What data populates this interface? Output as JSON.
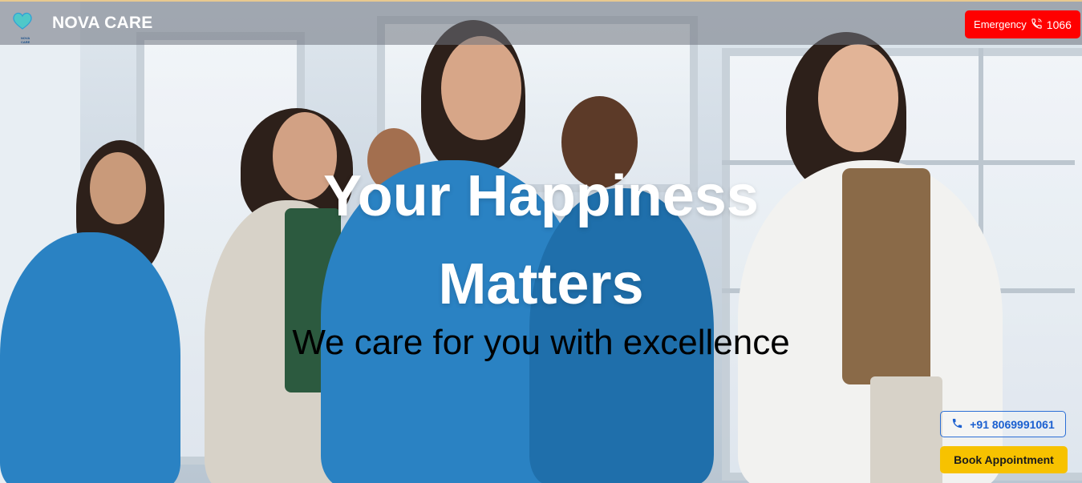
{
  "header": {
    "logo_text": "NOVA CARE",
    "brand": "NOVA CARE",
    "emergency_label": "Emergency",
    "emergency_number": "1066",
    "emergency_icon": "phone-icon"
  },
  "hero": {
    "title_line1": "Your Happiness",
    "title_line2": "Matters",
    "subtitle": "We care for you with excellence"
  },
  "actions": {
    "phone_number": "+91 8069991061",
    "phone_icon": "phone-icon",
    "book_label": "Book Appointment"
  },
  "colors": {
    "emergency": "#ff0000",
    "book": "#f7c200",
    "phone_border": "#2b6fd6"
  }
}
